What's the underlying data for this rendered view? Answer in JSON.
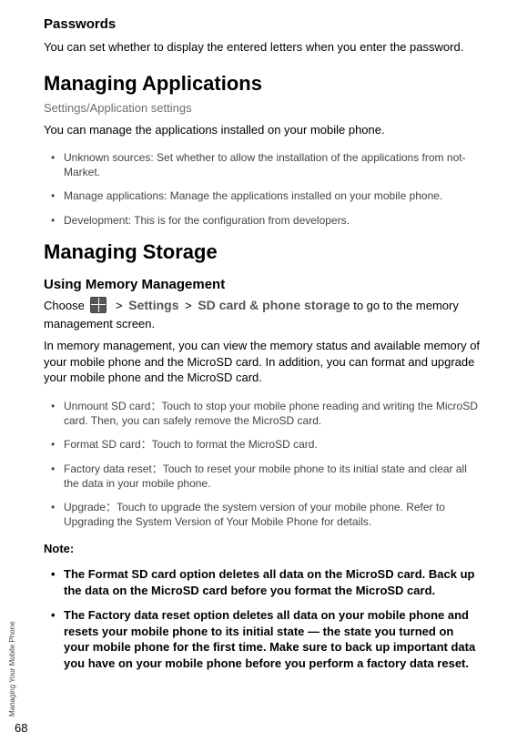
{
  "side_label": "Managing Your Mobile Phone",
  "page_number": "68",
  "passwords": {
    "title": "Passwords",
    "text": "You can set whether to display the entered letters when you enter the password."
  },
  "managing_apps": {
    "title": "Managing Applications",
    "breadcrumb": "Settings/Application settings",
    "intro": "You can manage the applications installed on your mobile phone.",
    "bullets": [
      "Unknown sources: Set whether to allow the installation of the applications from not-Market.",
      "Manage applications: Manage the applications installed on your mobile phone.",
      "Development: This is for the configuration from developers."
    ]
  },
  "managing_storage": {
    "title": "Managing Storage",
    "sub_title": "Using Memory Management",
    "choose_prefix": "Choose ",
    "gt1": ">",
    "path1": "Settings",
    "gt2": ">",
    "path2": "SD card & phone storage",
    "choose_suffix": " to go to the memory management screen.",
    "para2": "In memory management, you can view the memory status and available memory of your mobile phone and the MicroSD card. In addition, you can format and upgrade your mobile phone and the MicroSD card.",
    "bullets": [
      "Unmount SD card：Touch to stop your mobile phone reading and writing the MicroSD card. Then, you can safely remove the MicroSD card.",
      "Format SD card：Touch to format the MicroSD card.",
      "Factory data reset：Touch to reset your mobile phone to its initial state and clear all the data in your mobile phone.",
      "Upgrade：Touch to upgrade the system version of your mobile phone. Refer to Upgrading the System Version of Your Mobile Phone for details."
    ],
    "note_label": "Note:",
    "notes": [
      "The Format SD card option deletes all data on the MicroSD card. Back up the data on the MicroSD card before you format the MicroSD card.",
      "The Factory data reset option deletes all data on your mobile phone and resets your mobile phone to its initial state — the state you turned on your mobile phone for the first time. Make sure to back up important data you have on your mobile phone before you perform a factory data reset."
    ]
  }
}
